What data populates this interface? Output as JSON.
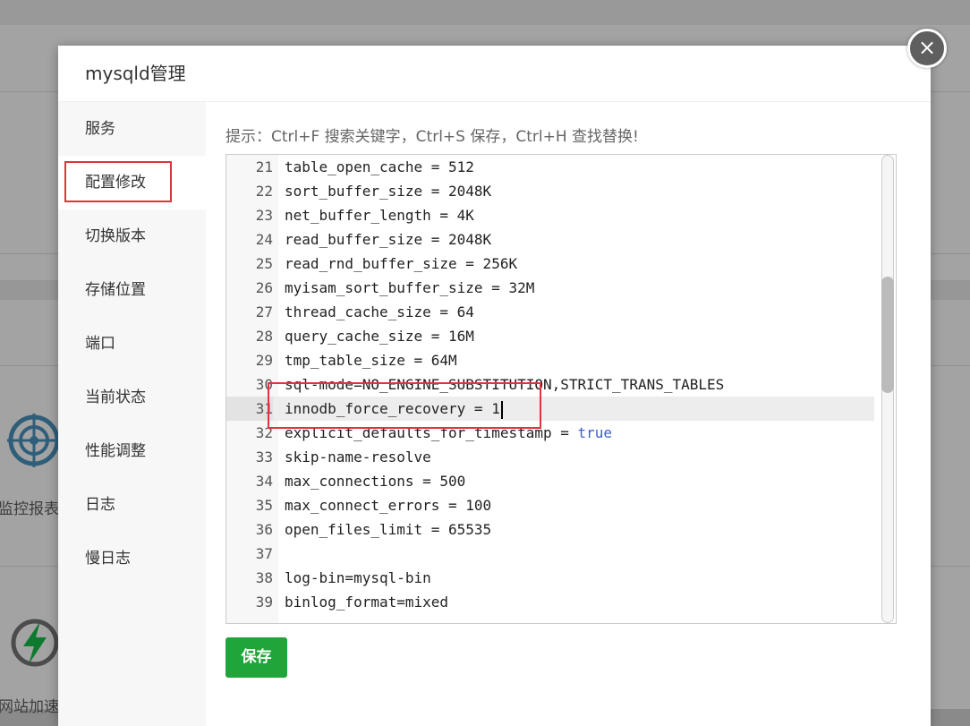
{
  "background": {
    "labels": {
      "monitor": "监控报表",
      "website_accel": "网站加速"
    },
    "icons": [
      "radar-icon",
      "bolt-icon"
    ]
  },
  "modal": {
    "title": "mysqld管理",
    "close_icon": "×",
    "sidebar": [
      {
        "label": "服务"
      },
      {
        "label": "配置修改"
      },
      {
        "label": "切换版本"
      },
      {
        "label": "存储位置"
      },
      {
        "label": "端口"
      },
      {
        "label": "当前状态"
      },
      {
        "label": "性能调整"
      },
      {
        "label": "日志"
      },
      {
        "label": "慢日志"
      }
    ],
    "active_tab": "配置修改",
    "tip": "提示：Ctrl+F 搜索关键字，Ctrl+S 保存，Ctrl+H 查找替换!",
    "editor": {
      "current_line": 31,
      "lines": [
        {
          "num": "21",
          "code": "table_open_cache = 512"
        },
        {
          "num": "22",
          "code": "sort_buffer_size = 2048K"
        },
        {
          "num": "23",
          "code": "net_buffer_length = 4K"
        },
        {
          "num": "24",
          "code": "read_buffer_size = 2048K"
        },
        {
          "num": "25",
          "code": "read_rnd_buffer_size = 256K"
        },
        {
          "num": "26",
          "code": "myisam_sort_buffer_size = 32M"
        },
        {
          "num": "27",
          "code": "thread_cache_size = 64"
        },
        {
          "num": "28",
          "code": "query_cache_size = 16M"
        },
        {
          "num": "29",
          "code": "tmp_table_size = 64M"
        },
        {
          "num": "30",
          "code": "sql-mode=NO_ENGINE_SUBSTITUTION,STRICT_TRANS_TABLES"
        },
        {
          "num": "31",
          "code": "innodb_force_recovery = 1"
        },
        {
          "num": "32",
          "code": "explicit_defaults_for_timestamp = ",
          "code_keyword": "true"
        },
        {
          "num": "33",
          "code": "skip-name-resolve"
        },
        {
          "num": "34",
          "code": "max_connections = 500"
        },
        {
          "num": "35",
          "code": "max_connect_errors = 100"
        },
        {
          "num": "36",
          "code": "open_files_limit = 65535"
        },
        {
          "num": "37",
          "code": ""
        },
        {
          "num": "38",
          "code": "log-bin=mysql-bin"
        },
        {
          "num": "39",
          "code": "binlog_format=mixed"
        }
      ]
    },
    "save_label": "保存"
  },
  "colors": {
    "save_green": "#20a53a",
    "highlight_red": "#d9363e",
    "keyword_blue": "#3d5ec9"
  }
}
